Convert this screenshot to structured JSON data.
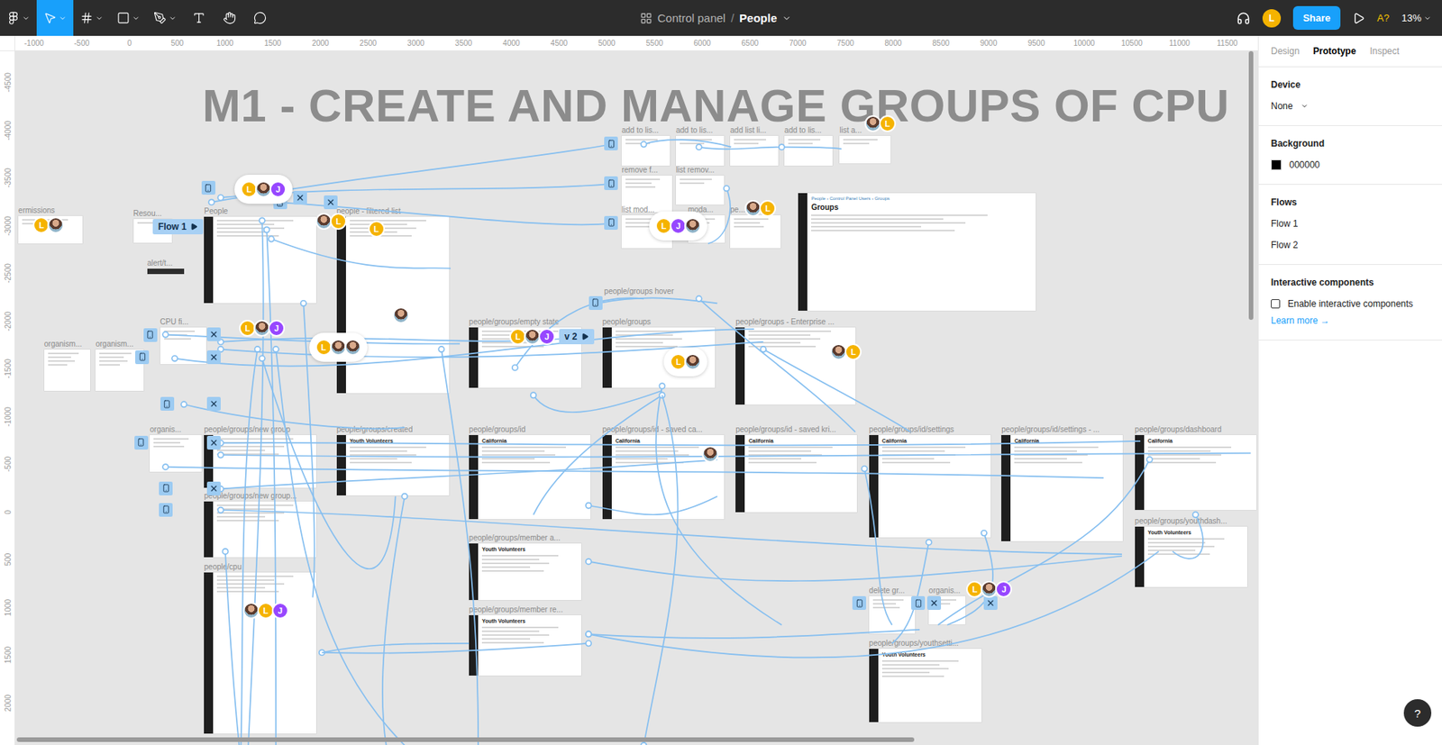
{
  "toolbar": {
    "tools": [
      {
        "selected": false
      },
      {
        "selected": true
      },
      {
        "selected": false
      },
      {
        "selected": false
      },
      {
        "selected": false
      },
      {
        "selected": false
      },
      {
        "selected": false
      },
      {
        "selected": false
      }
    ],
    "breadcrumb": {
      "file": "Control panel",
      "separator": "/",
      "page": "People"
    },
    "user": {
      "label": "L",
      "color": "#f5b300"
    },
    "share": "Share",
    "accessibility": "A?",
    "zoom": "13%"
  },
  "rulers": {
    "top": [
      "-1000",
      "-500",
      "0",
      "500",
      "1000",
      "1500",
      "2000",
      "2500",
      "3000",
      "3500",
      "4000",
      "4500",
      "5000",
      "5500",
      "6000",
      "6500",
      "7000",
      "7500",
      "8000",
      "8500",
      "9000",
      "9500",
      "10000",
      "10500",
      "11000",
      "11500"
    ],
    "left": [
      "-4500",
      "-4000",
      "-3500",
      "-3000",
      "-2500",
      "-2000",
      "-1500",
      "-1000",
      "-500",
      "0",
      "500",
      "1000",
      "1500",
      "2000"
    ]
  },
  "canvas": {
    "title": "M1 - CREATE AND MANAGE GROUPS OF CPU",
    "frames": [
      {
        "label": "add to lis...",
        "kind": "modal"
      },
      {
        "label": "add to lis...",
        "kind": "modal"
      },
      {
        "label": "add list li...",
        "kind": "modal"
      },
      {
        "label": "add to lis...",
        "kind": "modal"
      },
      {
        "label": "list a...",
        "kind": "modal"
      },
      {
        "label": "remove f...",
        "kind": "modal"
      },
      {
        "label": "list remov...",
        "kind": "modal"
      },
      {
        "label": "list mod...",
        "kind": "modal"
      },
      {
        "label": "moda...",
        "kind": "modal"
      },
      {
        "label": "pe...",
        "kind": "modal"
      },
      {
        "label": "",
        "kind": "page",
        "crumb": "People › Control Panel Users › Groups",
        "heading": "Groups"
      },
      {
        "label": "People",
        "kind": "page"
      },
      {
        "label": "people - filtered list",
        "kind": "page"
      },
      {
        "label": "ermissions",
        "kind": "modal"
      },
      {
        "label": "Resou...",
        "kind": "modal"
      },
      {
        "label": "alert/t...",
        "kind": "bar"
      },
      {
        "label": "CPU fi...",
        "kind": "modal"
      },
      {
        "label": "organism...",
        "kind": "modal"
      },
      {
        "label": "organism...",
        "kind": "modal"
      },
      {
        "label": "people/groups/empty state",
        "kind": "page"
      },
      {
        "label": "people/groups",
        "kind": "page"
      },
      {
        "label": "people/groups - Enterprise ...",
        "kind": "page"
      },
      {
        "label": "organis...",
        "kind": "modal"
      },
      {
        "label": "people/groups/new group",
        "kind": "page"
      },
      {
        "label": "people/groups/created",
        "kind": "page",
        "heading": "Youth Volunteers"
      },
      {
        "label": "people/groups/id",
        "kind": "page",
        "heading": "California"
      },
      {
        "label": "people/groups/id - saved ca...",
        "kind": "page",
        "heading": "California"
      },
      {
        "label": "people/groups/id - saved kri...",
        "kind": "page",
        "heading": "California"
      },
      {
        "label": "people/groups/id/settings",
        "kind": "page",
        "heading": "California"
      },
      {
        "label": "people/groups/id/settings - ...",
        "kind": "page",
        "heading": "California"
      },
      {
        "label": "people/groups/dashboard",
        "kind": "page",
        "heading": "California"
      },
      {
        "label": "people/groups/youthdash...",
        "kind": "page",
        "heading": "Youth Volunteers"
      },
      {
        "label": "people/groups/new group...",
        "kind": "page"
      },
      {
        "label": "people/cpu",
        "kind": "page"
      },
      {
        "label": "people/groups/member a...",
        "kind": "page",
        "heading": "Youth Volunteers"
      },
      {
        "label": "people/groups/member re...",
        "kind": "page",
        "heading": "Youth Volunteers"
      },
      {
        "label": "delete gr...",
        "kind": "modal"
      },
      {
        "label": "organis...",
        "kind": "modal"
      },
      {
        "label": "people/groups/youthsetti...",
        "kind": "page",
        "heading": "Youth Volunteers"
      },
      {
        "label": "people/groups hover",
        "kind": "label"
      }
    ],
    "flows": [
      {
        "label": "Flow 1"
      },
      {
        "label": "v 2"
      }
    ],
    "avatars": [
      {
        "members": [
          {
            "kind": "letter",
            "label": "L",
            "color": "#f5b300"
          },
          {
            "kind": "photo"
          }
        ]
      },
      {
        "members": [
          {
            "kind": "letter",
            "label": "L",
            "color": "#f5b300"
          },
          {
            "kind": "photo"
          },
          {
            "kind": "letter",
            "label": "J",
            "color": "#9747ff"
          }
        ]
      },
      {
        "members": [
          {
            "kind": "photo"
          },
          {
            "kind": "letter",
            "label": "L",
            "color": "#f5b300"
          }
        ]
      },
      {
        "members": [
          {
            "kind": "letter",
            "label": "L",
            "color": "#f5b300"
          }
        ]
      },
      {
        "members": [
          {
            "kind": "photo"
          }
        ]
      },
      {
        "members": [
          {
            "kind": "letter",
            "label": "L",
            "color": "#f5b300"
          },
          {
            "kind": "photo"
          },
          {
            "kind": "letter",
            "label": "J",
            "color": "#9747ff"
          }
        ]
      },
      {
        "members": [
          {
            "kind": "letter",
            "label": "L",
            "color": "#f5b300"
          },
          {
            "kind": "photo"
          },
          {
            "kind": "photo"
          }
        ]
      },
      {
        "members": [
          {
            "kind": "letter",
            "label": "L",
            "color": "#f5b300"
          },
          {
            "kind": "photo"
          },
          {
            "kind": "letter",
            "label": "J",
            "color": "#9747ff"
          }
        ]
      },
      {
        "members": [
          {
            "kind": "letter",
            "label": "L",
            "color": "#f5b300"
          },
          {
            "kind": "photo"
          }
        ]
      },
      {
        "members": [
          {
            "kind": "photo"
          },
          {
            "kind": "letter",
            "label": "L",
            "color": "#f5b300"
          }
        ]
      },
      {
        "members": [
          {
            "kind": "photo"
          }
        ]
      },
      {
        "members": [
          {
            "kind": "photo"
          },
          {
            "kind": "letter",
            "label": "L",
            "color": "#f5b300"
          },
          {
            "kind": "letter",
            "label": "J",
            "color": "#9747ff"
          }
        ]
      },
      {
        "members": [
          {
            "kind": "letter",
            "label": "L",
            "color": "#f5b300"
          },
          {
            "kind": "photo"
          },
          {
            "kind": "letter",
            "label": "J",
            "color": "#9747ff"
          }
        ]
      },
      {
        "members": [
          {
            "kind": "photo"
          },
          {
            "kind": "letter",
            "label": "L",
            "color": "#f5b300"
          }
        ]
      },
      {
        "members": [
          {
            "kind": "photo"
          },
          {
            "kind": "letter",
            "label": "L",
            "color": "#f5b300"
          }
        ]
      },
      {
        "members": [
          {
            "kind": "letter",
            "label": "L",
            "color": "#f5b300"
          },
          {
            "kind": "letter",
            "label": "J",
            "color": "#9747ff"
          },
          {
            "kind": "photo"
          }
        ]
      }
    ]
  },
  "panel": {
    "tabs": [
      {
        "label": "Design",
        "selected": false
      },
      {
        "label": "Prototype",
        "selected": true
      },
      {
        "label": "Inspect",
        "selected": false
      }
    ],
    "device": {
      "label": "Device",
      "value": "None"
    },
    "background": {
      "label": "Background",
      "value": "000000"
    },
    "flows": {
      "label": "Flows",
      "items": [
        "Flow 1",
        "Flow 2"
      ]
    },
    "interactive": {
      "label": "Interactive components",
      "checkbox": {
        "label": "Enable interactive components",
        "checked": false
      },
      "link": "Learn more →"
    },
    "help": "?"
  }
}
